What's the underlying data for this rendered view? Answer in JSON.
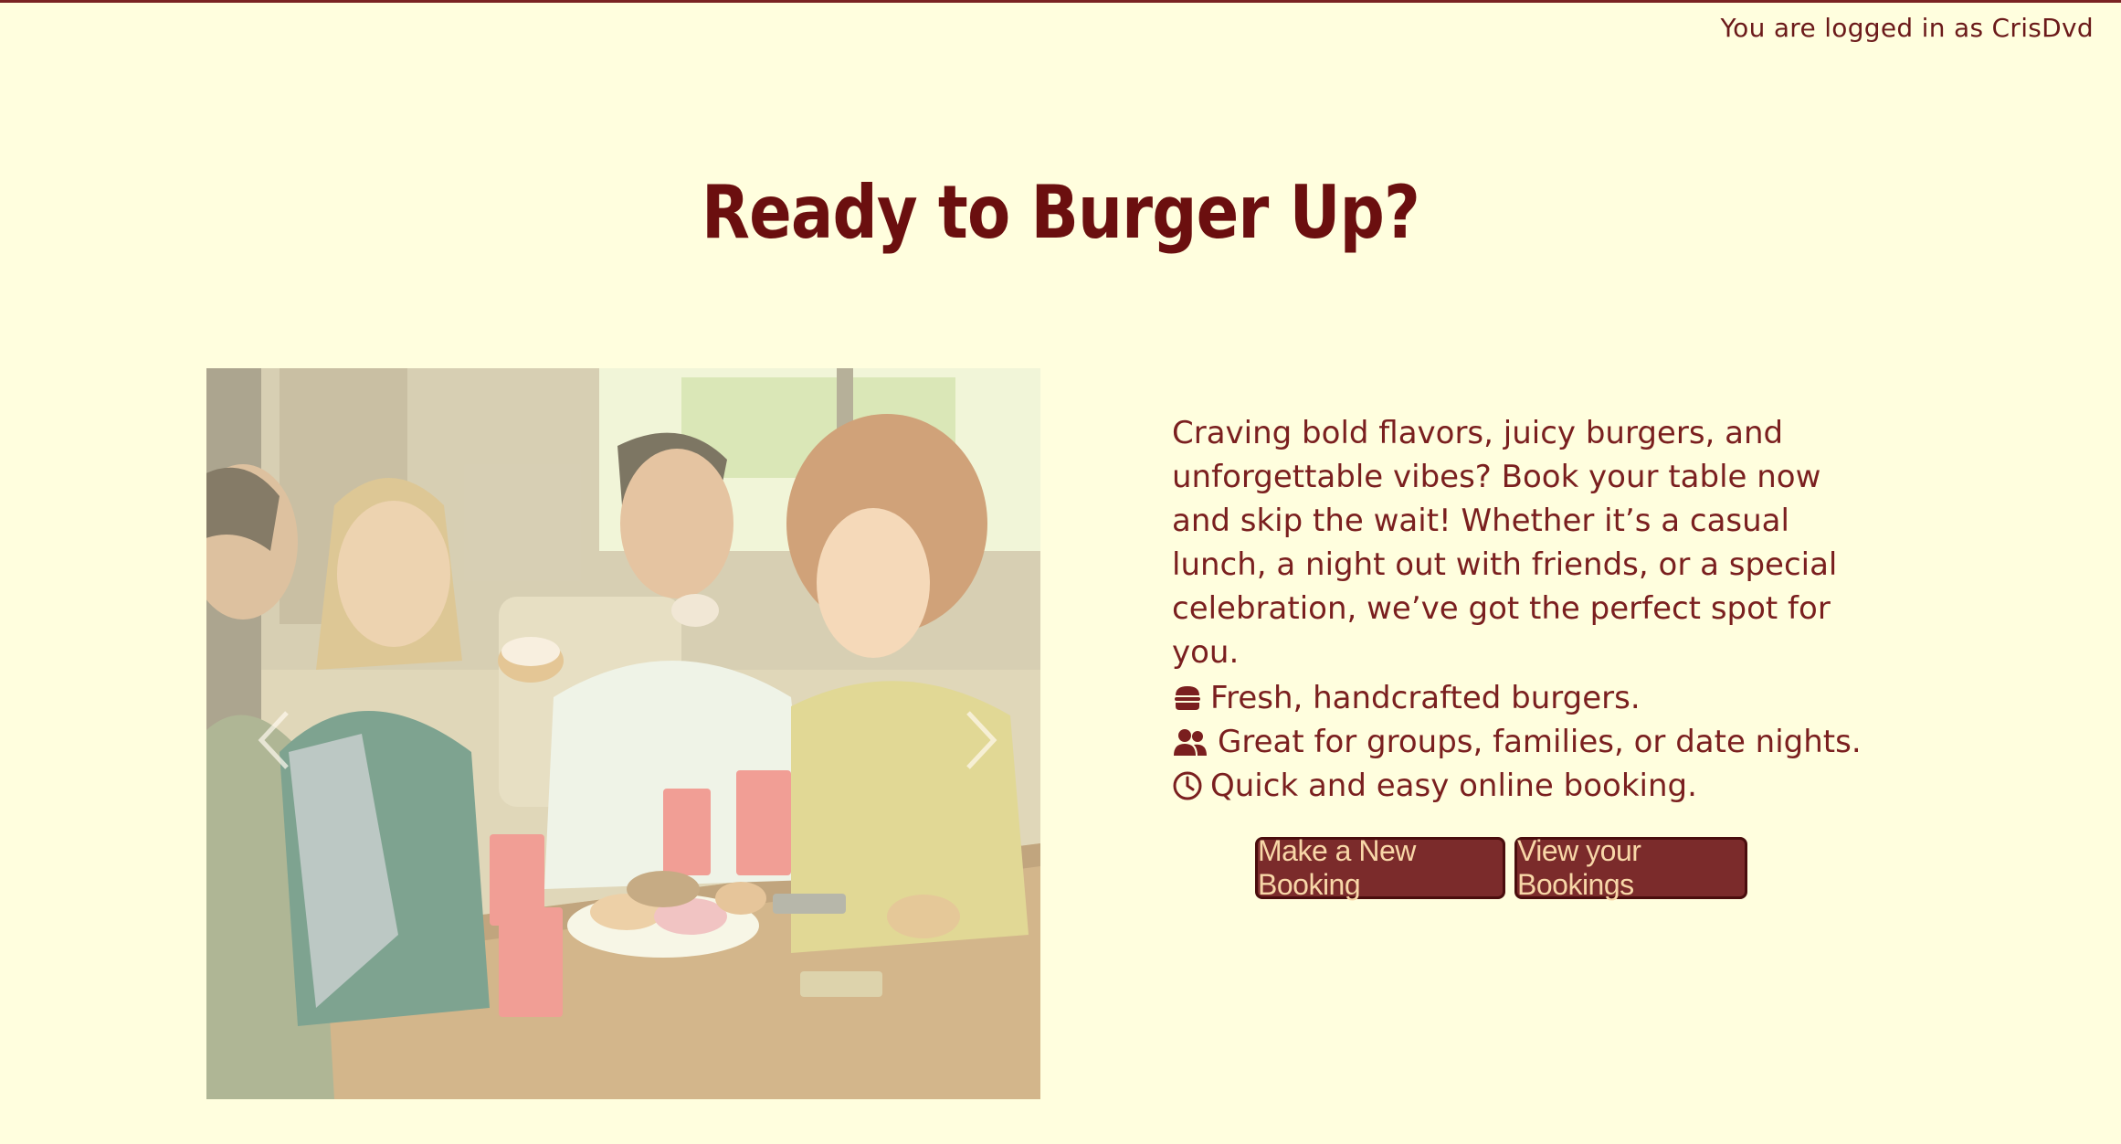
{
  "header": {
    "login_status": "You are logged in as CrisDvd"
  },
  "hero": {
    "title": "Ready to Burger Up?"
  },
  "intro": {
    "text": "Craving bold flavors, juicy burgers, and unforgettable vibes? Book your table now and skip the wait! Whether it’s a casual lunch, a night out with friends, or a special celebration, we’ve got the perfect spot for you."
  },
  "features": [
    {
      "icon": "burger-icon",
      "text": "Fresh, handcrafted burgers."
    },
    {
      "icon": "users-icon",
      "text": "Great for groups, families, or date nights."
    },
    {
      "icon": "clock-icon",
      "text": "Quick and easy online booking."
    }
  ],
  "actions": {
    "new_booking_label": "Make a New Booking",
    "view_bookings_label": "View your Bookings"
  },
  "carousel": {
    "image_subject": "friends laughing and eating donuts at a cafe table",
    "controls": [
      "prev-arrow-icon",
      "next-arrow-icon"
    ]
  },
  "colors": {
    "background": "#fffede",
    "text": "#6b1a1a",
    "button_bg": "#7b2b2b",
    "button_text": "#f8d7a8",
    "button_border": "#4a0d0d"
  }
}
